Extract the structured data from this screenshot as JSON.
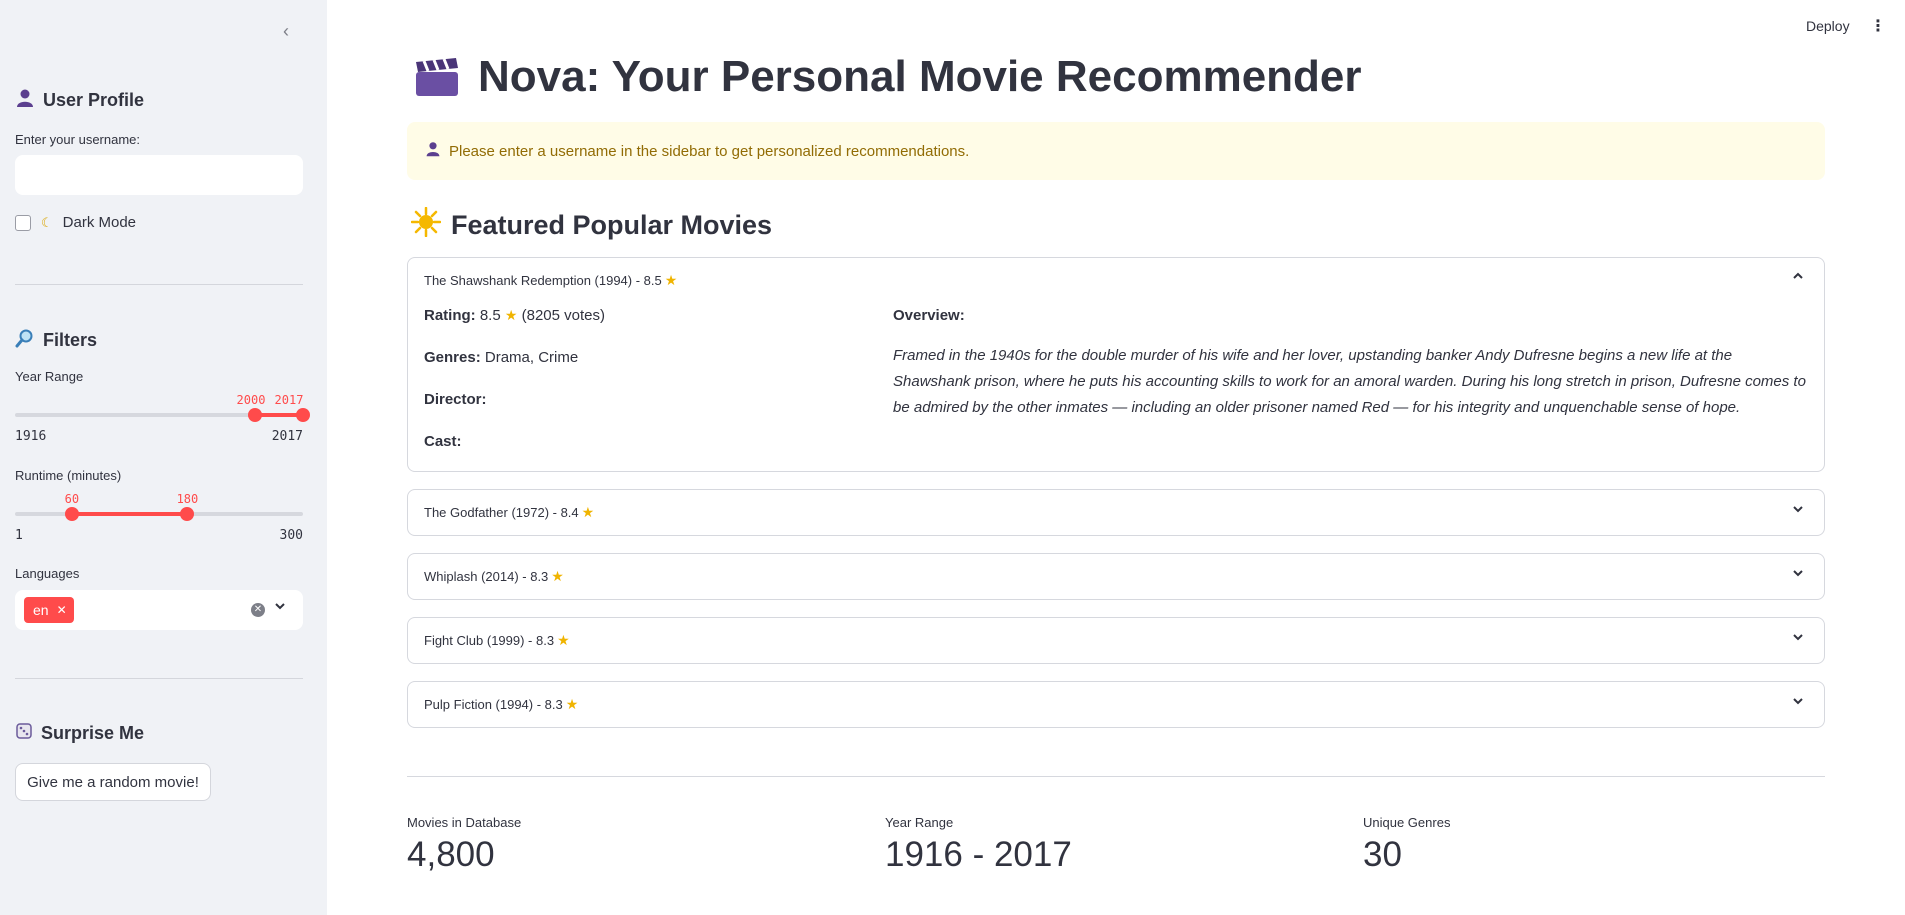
{
  "sidebar": {
    "profile_heading": "User Profile",
    "username_label": "Enter your username:",
    "username_value": "",
    "dark_mode_label": "Dark Mode",
    "filters_heading": "Filters",
    "year_range": {
      "label": "Year Range",
      "min": 1916,
      "max": 2017,
      "low": 2000,
      "high": 2017
    },
    "runtime": {
      "label": "Runtime (minutes)",
      "min": 1,
      "max": 300,
      "low": 60,
      "high": 180
    },
    "languages_label": "Languages",
    "language_tag": "en",
    "surprise_heading": "Surprise Me",
    "random_button": "Give me a random movie!"
  },
  "header": {
    "deploy": "Deploy",
    "menu_icon": "kebab-menu-icon"
  },
  "main": {
    "title": "Nova: Your Personal Movie Recommender",
    "alert": "Please enter a username in the sidebar to get personalized recommendations.",
    "featured_heading": "Featured Popular Movies",
    "movies": [
      {
        "title": "The Shawshank Redemption (1994) - 8.5",
        "expanded": true,
        "rating_label": "Rating:",
        "rating_value": "8.5",
        "votes": "(8205 votes)",
        "genres_label": "Genres:",
        "genres": "Drama, Crime",
        "director_label": "Director:",
        "cast_label": "Cast:",
        "overview_label": "Overview:",
        "overview": "Framed in the 1940s for the double murder of his wife and her lover, upstanding banker Andy Dufresne begins a new life at the Shawshank prison, where he puts his accounting skills to work for an amoral warden. During his long stretch in prison, Dufresne comes to be admired by the other inmates — including an older prisoner named Red — for his integrity and unquenchable sense of hope."
      },
      {
        "title": "The Godfather (1972) - 8.4"
      },
      {
        "title": "Whiplash (2014) - 8.3"
      },
      {
        "title": "Fight Club (1999) - 8.3"
      },
      {
        "title": "Pulp Fiction (1994) - 8.3"
      }
    ],
    "metrics": [
      {
        "label": "Movies in Database",
        "value": "4,800"
      },
      {
        "label": "Year Range",
        "value": "1916 - 2017"
      },
      {
        "label": "Unique Genres",
        "value": "30"
      }
    ]
  },
  "colors": {
    "accent": "#ff4b4b",
    "sidebar_bg": "#f0f2f6",
    "alert_bg": "#fffce7",
    "alert_text": "#926c05",
    "star": "#f0b400"
  }
}
